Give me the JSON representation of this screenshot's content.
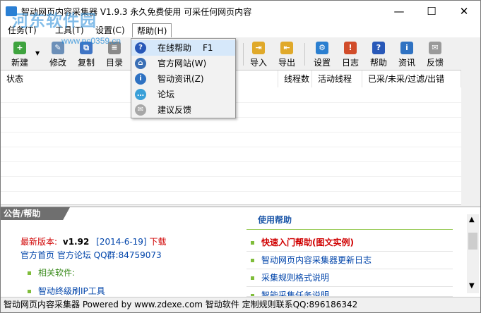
{
  "window": {
    "title": "智动网页内容采集器 V1.9.3 永久免费使用 可采任何网页内容",
    "minimize": "—",
    "maximize": "☐",
    "close": "✕"
  },
  "watermark": {
    "name": "河东软件园",
    "url": "www.pc0359.cn"
  },
  "menu": [
    "任务(T)",
    "工具(T)",
    "设置(C)",
    "帮助(H)"
  ],
  "toolbar": [
    {
      "label": "新建",
      "icon": "new-icon",
      "color": "#3ea33e",
      "glyph": "+"
    },
    {
      "label": "修改",
      "icon": "edit-icon",
      "color": "#6c8fb8",
      "glyph": "✎"
    },
    {
      "label": "复制",
      "icon": "copy-icon",
      "color": "#3f74c4",
      "glyph": "⧉"
    },
    {
      "label": "目录",
      "icon": "folder-list-icon",
      "color": "#8a8a8a",
      "glyph": "≡"
    },
    {
      "label": "导入",
      "icon": "import-icon",
      "color": "#e0a92a",
      "glyph": "⇥"
    },
    {
      "label": "导出",
      "icon": "export-icon",
      "color": "#e0a92a",
      "glyph": "⇤"
    },
    {
      "label": "设置",
      "icon": "settings-icon",
      "color": "#2b7fd0",
      "glyph": "⚙"
    },
    {
      "label": "日志",
      "icon": "log-icon",
      "color": "#d14c2a",
      "glyph": "!"
    },
    {
      "label": "帮助",
      "icon": "help-icon",
      "color": "#2858b8",
      "glyph": "?"
    },
    {
      "label": "资讯",
      "icon": "info-icon",
      "color": "#2f72c2",
      "glyph": "i"
    },
    {
      "label": "反馈",
      "icon": "feedback-icon",
      "color": "#9a9a9a",
      "glyph": "✉"
    }
  ],
  "grid": {
    "columns": [
      "状态",
      "线程数",
      "活动线程",
      "已采/未采/过滤/出错"
    ]
  },
  "help_menu": [
    {
      "label": "在线帮助",
      "shortcut": "F1",
      "icon": "question-circle-icon",
      "color": "#2858b8",
      "glyph": "?"
    },
    {
      "label": "官方网站(W)",
      "shortcut": "",
      "icon": "home-icon",
      "color": "#3a6fb5",
      "glyph": "⌂"
    },
    {
      "label": "智动资讯(Z)",
      "shortcut": "",
      "icon": "info-circle-icon",
      "color": "#2f72c2",
      "glyph": "i"
    },
    {
      "label": "论坛",
      "shortcut": "",
      "icon": "chat-bubble-icon",
      "color": "#3aa0d8",
      "glyph": "…"
    },
    {
      "label": "建议反馈",
      "shortcut": "",
      "icon": "note-icon",
      "color": "#a7a7a7",
      "glyph": "✉"
    }
  ],
  "notice": {
    "tab_label": "公告/帮助",
    "latest_label": "最新版本:",
    "latest_version": "v1.92",
    "latest_date": "[2014-6-19]",
    "download": "下载",
    "links": "官方首页 官方论坛 QQ群:",
    "qq_group": "84759073",
    "related_label": "相关软件:",
    "related_item": "智动终级刷IP工具",
    "help_title": "使用帮助",
    "help_items": [
      "快速入门帮助(图文实例)",
      "智动网页内容采集器更新日志",
      "采集规则格式说明",
      "智能采集任务说明"
    ]
  },
  "status_bar": "智动网页内容采集器 Powered by www.zdexe.com 智动软件 定制规则联系QQ:896186342"
}
